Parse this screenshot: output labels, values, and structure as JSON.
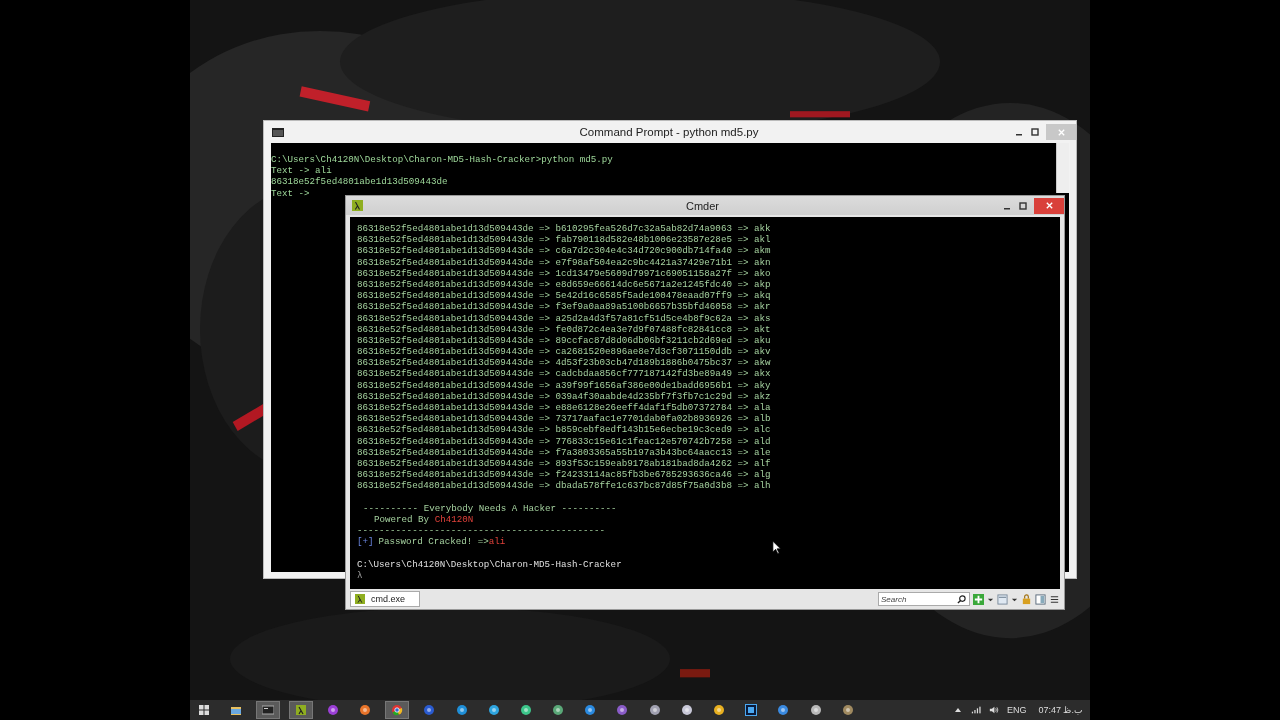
{
  "cmd_window": {
    "title": "Command Prompt - python  md5.py",
    "lines": [
      "C:\\Users\\Ch4120N\\Desktop\\Charon-MD5-Hash-Cracker>python md5.py",
      "Text -> ali",
      "86318e52f5ed4801abe1d13d509443de",
      "Text ->"
    ]
  },
  "cmder_window": {
    "title": "Cmder",
    "rows": [
      "86318e52f5ed4801abe1d13d509443de => b610295fea526d7c32a5ab82d74a9063 => akk",
      "86318e52f5ed4801abe1d13d509443de => fab790118d582e48b1006e23587e28e5 => akl",
      "86318e52f5ed4801abe1d13d509443de => c6a7d2c304e4c34d720c900db714fa40 => akm",
      "86318e52f5ed4801abe1d13d509443de => e7f98af504ea2c9bc4421a37429e71b1 => akn",
      "86318e52f5ed4801abe1d13d509443de => 1cd13479e5609d79971c69051158a27f => ako",
      "86318e52f5ed4801abe1d13d509443de => e8d659e66614dc6e5671a2e1245fdc40 => akp",
      "86318e52f5ed4801abe1d13d509443de => 5e42d16c6585f5ade100478eaad07ff9 => akq",
      "86318e52f5ed4801abe1d13d509443de => f3ef9a0aa89a5100b6657b35bfd46058 => akr",
      "86318e52f5ed4801abe1d13d509443de => a25d2a4d3f57a81cf51d5ce4b8f9c62a => aks",
      "86318e52f5ed4801abe1d13d509443de => fe0d872c4ea3e7d9f07488fc82841cc8 => akt",
      "86318e52f5ed4801abe1d13d509443de => 89ccfac87d8d06db06bf3211cb2d69ed => aku",
      "86318e52f5ed4801abe1d13d509443de => ca2681520e896ae8e7d3cf3071150ddb => akv",
      "86318e52f5ed4801abe1d13d509443de => 4d53f23b03cb47d189b1886b0475bc37 => akw",
      "86318e52f5ed4801abe1d13d509443de => cadcbdaa856cf777187142fd3be89a49 => akx",
      "86318e52f5ed4801abe1d13d509443de => a39f99f1656af386e00de1badd6956b1 => aky",
      "86318e52f5ed4801abe1d13d509443de => 039a4f30aabde4d235bf7f3fb7c1c29d => akz",
      "86318e52f5ed4801abe1d13d509443de => e88e6128e26eeff4daf1f5db07372784 => ala",
      "86318e52f5ed4801abe1d13d509443de => 73717aafac1e7701dab0fa02b8936926 => alb",
      "86318e52f5ed4801abe1d13d509443de => b859cebf8edf143b15e6ecbe19c3ced9 => alc",
      "86318e52f5ed4801abe1d13d509443de => 776833c15e61c1feac12e570742b7258 => ald",
      "86318e52f5ed4801abe1d13d509443de => f7a3803365a55b197a3b43bc64aacc13 => ale",
      "86318e52f5ed4801abe1d13d509443de => 893f53c159eab9178ab181bad8da4262 => alf",
      "86318e52f5ed4801abe1d13d509443de => f24233114ac85fb3be6785293636ca46 => alg",
      "86318e52f5ed4801abe1d13d509443de => dbada578ffe1c637bc87d85f75a0d3b8 => alh"
    ],
    "banner": "---------- Everybody Needs A Hacker ----------",
    "powered_by": {
      "label": "Powered By",
      "name": "Ch4120N"
    },
    "separator": "---------------------------------------------",
    "cracked": {
      "marker": "[+]",
      "label": "Password Cracked! =>",
      "password": "ali"
    },
    "prompt_path": "C:\\Users\\Ch4120N\\Desktop\\Charon-MD5-Hash-Cracker",
    "prompt": "λ",
    "tab": {
      "label": "cmd.exe",
      "selected": true
    },
    "search": {
      "placeholder": "Search"
    }
  },
  "taskbar": {
    "items": [
      {
        "kind": "windows",
        "selected": false
      },
      {
        "kind": "folder",
        "selected": false
      },
      {
        "kind": "console",
        "selected": true
      },
      {
        "kind": "lambda",
        "selected": true
      },
      {
        "kind": "orb",
        "color": "#9b3fd6",
        "selected": false
      },
      {
        "kind": "orb",
        "color": "#e8742a",
        "selected": false
      },
      {
        "kind": "chrome",
        "selected": true
      },
      {
        "kind": "orb",
        "color": "#2a5bd0",
        "selected": false
      },
      {
        "kind": "orb",
        "color": "#1f8fd8",
        "selected": false
      },
      {
        "kind": "orb",
        "color": "#2ea5e0",
        "selected": false
      },
      {
        "kind": "orb",
        "color": "#3cc58a",
        "selected": false
      },
      {
        "kind": "orb",
        "color": "#5aa878",
        "selected": false
      },
      {
        "kind": "orb",
        "color": "#2a8ae0",
        "selected": false
      },
      {
        "kind": "orb",
        "color": "#8a5cc8",
        "selected": false
      },
      {
        "kind": "orb",
        "color": "#a0a0b0",
        "selected": false
      },
      {
        "kind": "orb",
        "color": "#c8c8d8",
        "selected": false
      },
      {
        "kind": "orb",
        "color": "#e8b020",
        "selected": false
      },
      {
        "kind": "ps",
        "selected": false
      },
      {
        "kind": "orb",
        "color": "#3a8ae0",
        "selected": false
      },
      {
        "kind": "orb",
        "color": "#b8b8b8",
        "selected": false
      },
      {
        "kind": "orb",
        "color": "#a08a60",
        "selected": false
      }
    ],
    "language": "ENG",
    "time": "07:47 ب.ظ"
  }
}
